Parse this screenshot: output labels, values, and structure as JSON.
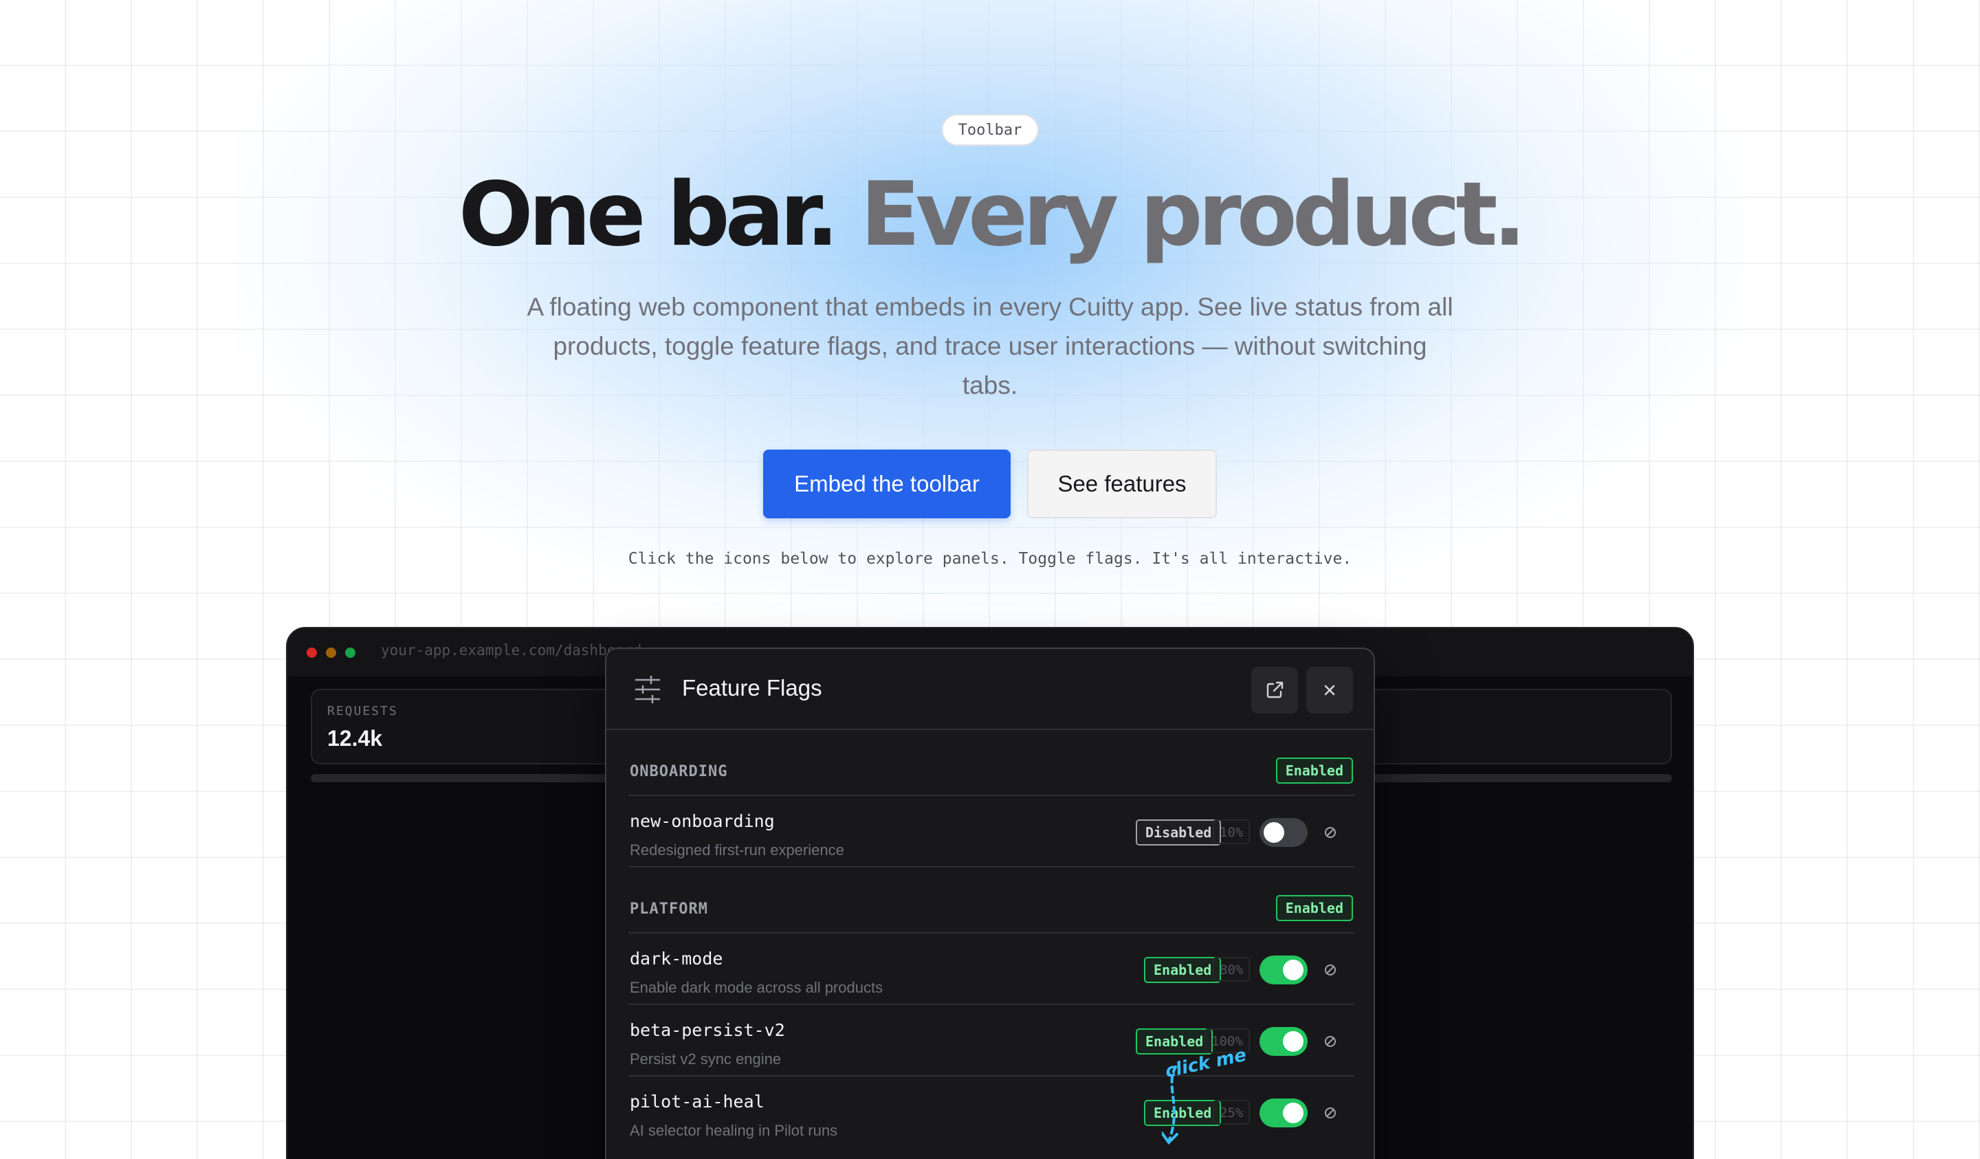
{
  "hero": {
    "pill": "Toolbar",
    "headline_dark": "One bar.",
    "headline_grey": "Every product.",
    "subtitle": "A floating web component that embeds in every Cuitty app. See live status from all products, toggle feature flags, and trace user interactions — without switching tabs.",
    "primary_button": "Embed the toolbar",
    "secondary_button": "See features",
    "hint": "Click the icons below to explore panels. Toggle flags. It's all interactive."
  },
  "browser": {
    "url": "your-app.example.com/dashboard",
    "stat_label": "REQUESTS",
    "stat_value": "12.4k"
  },
  "panel": {
    "title": "Feature Flags",
    "groups": [
      {
        "name": "ONBOARDING",
        "status": "Enabled",
        "flags": [
          {
            "name": "new-onboarding",
            "description": "Redesigned first-run experience",
            "status": "Disabled",
            "rollout": "10%",
            "on": false
          }
        ]
      },
      {
        "name": "PLATFORM",
        "status": "Enabled",
        "flags": [
          {
            "name": "dark-mode",
            "description": "Enable dark mode across all products",
            "status": "Enabled",
            "rollout": "80%",
            "on": true
          },
          {
            "name": "beta-persist-v2",
            "description": "Persist v2 sync engine",
            "status": "Enabled",
            "rollout": "100%",
            "on": true
          },
          {
            "name": "pilot-ai-heal",
            "description": "AI selector healing in Pilot runs",
            "status": "Enabled",
            "rollout": "25%",
            "on": true
          }
        ]
      }
    ]
  },
  "annotation": {
    "text": "click me"
  },
  "colors": {
    "primary": "#2563eb",
    "enabled": "#22c55e",
    "panel_bg": "#18181b",
    "annotation": "#38bdf8"
  },
  "icons": {
    "panel": "sliders-icon",
    "external": "external-link-icon",
    "close": "close-icon",
    "reset": "reset-icon"
  }
}
